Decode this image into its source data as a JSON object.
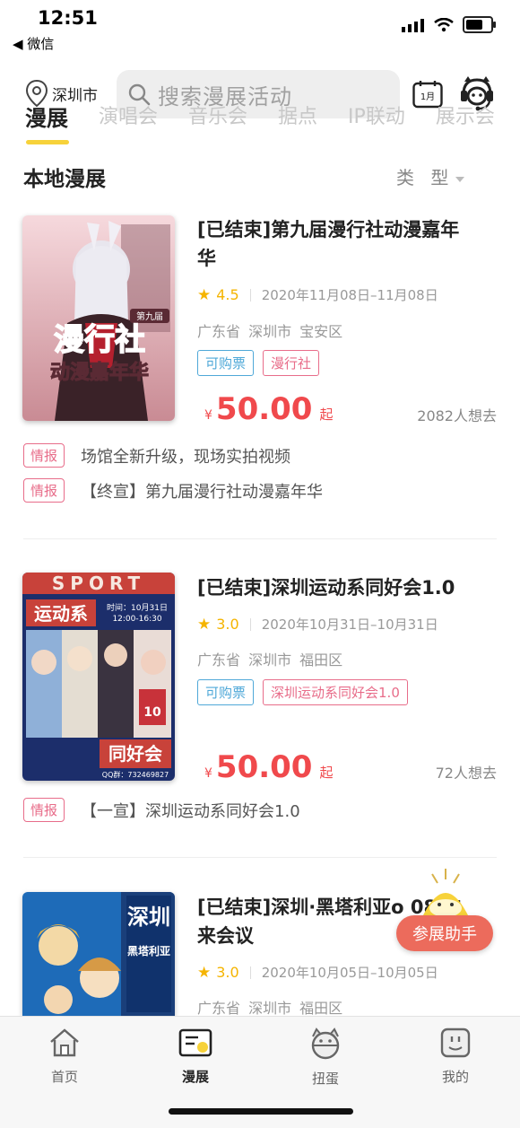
{
  "status": {
    "time": "12:51",
    "back": "◀ 微信"
  },
  "header": {
    "city": "深圳市",
    "search_placeholder": "搜索漫展活动",
    "calendar_label": "1月"
  },
  "tabs": [
    "漫展",
    "演唱会",
    "音乐会",
    "据点",
    "IP联动",
    "展示会"
  ],
  "section": {
    "title": "本地漫展",
    "type_filter": "类 型"
  },
  "events": [
    {
      "title": "[已结束]第九届漫行社动漫嘉年华",
      "score": "4.5",
      "dates": "2020年11月08日–11月08日",
      "location": "广东省 深圳市 宝安区",
      "tags": [
        "可购票",
        "漫行社"
      ],
      "currency": "¥",
      "price": "50.00",
      "price_suffix": "起",
      "want": "2082人想去",
      "news": [
        {
          "badge": "情报",
          "text": "场馆全新升级，现场实拍视频"
        },
        {
          "badge": "情报",
          "text": "【终宣】第九届漫行社动漫嘉年华"
        }
      ],
      "cover": {
        "badge": "第九届",
        "line1": "漫行社",
        "line2": "动漫嘉年华"
      }
    },
    {
      "title": "[已结束]深圳运动系同好会1.0",
      "score": "3.0",
      "dates": "2020年10月31日–10月31日",
      "location": "广东省 深圳市 福田区",
      "tags": [
        "可购票",
        "深圳运动系同好会1.0"
      ],
      "currency": "¥",
      "price": "50.00",
      "price_suffix": "起",
      "want": "72人想去",
      "news": [
        {
          "badge": "情报",
          "text": "【一宣】深圳运动系同好会1.0"
        }
      ],
      "cover": {
        "top": "SPORT",
        "name": "运动系",
        "time1": "时间：10月31日",
        "time2": "12:00-16:30",
        "bottom": "同好会",
        "qq": "QQ群：732469827"
      }
    },
    {
      "title": "[已结束]深圳·黑塔利亚o 08 未来会议",
      "score": "3.0",
      "dates": "2020年10月05日–10月05日",
      "location": "广东省 深圳市 福田区",
      "cover": {
        "line1": "深圳",
        "line2": "黑塔利亚"
      }
    }
  ],
  "helper_button": "参展助手",
  "tabbar": [
    {
      "label": "首页",
      "icon": "home-icon"
    },
    {
      "label": "漫展",
      "icon": "exhibition-icon"
    },
    {
      "label": "扭蛋",
      "icon": "gashapon-icon"
    },
    {
      "label": "我的",
      "icon": "profile-icon"
    }
  ],
  "colors": {
    "accent": "#f7d23a",
    "price": "#f0494c",
    "tag_blue": "#4fa8d8",
    "tag_pink": "#e86d8a",
    "helper": "#ec6b5c"
  }
}
